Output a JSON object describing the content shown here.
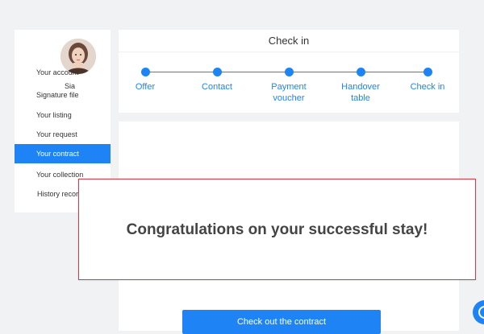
{
  "sidebar": {
    "user_name": "Sia",
    "items": [
      {
        "label": "Your account",
        "active": false
      },
      {
        "label": "Signature file",
        "active": false
      },
      {
        "label": "Your listing",
        "active": false
      },
      {
        "label": "Your request",
        "active": false
      },
      {
        "label": "Your contract",
        "active": true
      },
      {
        "label": "Your collection",
        "active": false
      },
      {
        "label": "History record",
        "active": false
      }
    ]
  },
  "checkin": {
    "title": "Check in",
    "steps": [
      {
        "label": "Offer"
      },
      {
        "label": "Contact"
      },
      {
        "label": "Payment voucher"
      },
      {
        "label": "Handover table"
      },
      {
        "label": "Check in"
      }
    ]
  },
  "main": {
    "button_label": "Check out the contract"
  },
  "modal": {
    "message": "Congratulations on your successful stay!"
  },
  "colors": {
    "accent": "#1e84f6",
    "modal_border": "#d63a47",
    "background": "#f1f2f4"
  },
  "icons": {
    "avatar": "user-avatar-photo",
    "chat": "chat-icon"
  }
}
